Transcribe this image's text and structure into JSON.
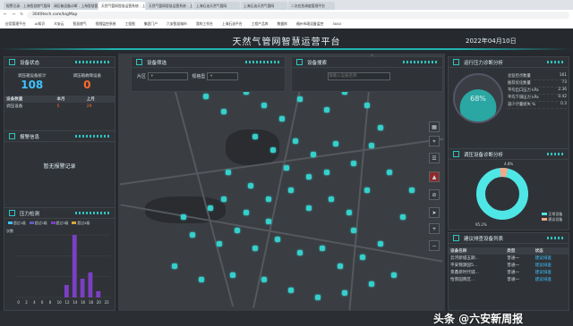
{
  "browser": {
    "tabs": [
      "报警记录 - 上海智慧燃气管网系统",
      "调压箱设备诊断 - 上海智慧管理平台",
      "天然气管网智慧运营系统 - 上海",
      "天然气管网智慧运营系统 - 上海",
      "上海石油天然气管网",
      "上海石油天然气管网",
      "二次应急调度管理平台"
    ],
    "url": "3040tech.com/bigMap",
    "bookmarks": [
      "应用管理平台",
      "AI知识",
      "众安云",
      "智慧燃气",
      "视频监控系统",
      "工程图",
      "集团门户",
      "六安智慧城市",
      "我的工作台",
      "上海石油平台",
      "工程产品库",
      "数据库",
      "福州市政设备监控",
      "3040"
    ]
  },
  "header": {
    "title": "天然气管网智慧运营平台",
    "date": "2022年04月10日"
  },
  "device_status": {
    "title": "设备状态",
    "total_label": "调压箱设备统计",
    "total": "108",
    "fault_label": "调压箱故障设备",
    "fault": "0",
    "cols": [
      "设备数量",
      "本月",
      "上月"
    ],
    "row": [
      "调压设备",
      "5",
      "29"
    ]
  },
  "alarm": {
    "title": "报警信息",
    "empty": "暂无报警记录"
  },
  "pressure": {
    "title": "压力检测",
    "legends": [
      "超过1级",
      "超过2级",
      "超过3级",
      "超过4级"
    ],
    "legend_colors": [
      "#3ec2ff",
      "#5b5fc7",
      "#7b3fc4",
      "#d6a83a"
    ],
    "unit": "次数",
    "xticks": [
      "0",
      "2",
      "4",
      "6",
      "8",
      "10",
      "12",
      "14",
      "16",
      "18",
      "20",
      "22"
    ]
  },
  "filter": {
    "title": "设备筛选",
    "area_label": "片区",
    "spec_label": "规格型"
  },
  "search": {
    "title": "设备搜索",
    "placeholder": "请输入设备名称"
  },
  "runtime": {
    "title": "运行压力诊断分析",
    "percent": "68%",
    "rows": [
      {
        "k": "总监控点数量",
        "v": "161"
      },
      {
        "k": "推荐优化数量",
        "v": "73"
      },
      {
        "k": "平均出口压力 kPa",
        "v": "2.36"
      },
      {
        "k": "平均下调压力 kPa",
        "v": "0.42"
      },
      {
        "k": "减少计量损失 %",
        "v": "0.3"
      }
    ]
  },
  "regulator": {
    "title": "调压设备诊断分析",
    "pct_small": "4.8%",
    "pct_big": "95.2%",
    "legend": [
      "正常设备",
      "建议设备"
    ],
    "colors": [
      "#4fe6e6",
      "#f2a98a"
    ]
  },
  "inspection": {
    "title": "建议排查设备列表",
    "cols": [
      "设备名称",
      "类型",
      "状态"
    ],
    "rows": [
      [
        "云河新城五期...",
        "普通一",
        "建议排查"
      ],
      [
        "平安锦源园5...",
        "普通一",
        "建议排查"
      ],
      [
        "景鑫新时代城...",
        "普通一",
        "建议排查"
      ],
      [
        "怡景园南区...",
        "普通一",
        "建议排查"
      ]
    ]
  },
  "watermark": "头条 @六安新周报",
  "chart_data": {
    "type": "bar",
    "title": "",
    "ylabel": "次数",
    "x": [
      0,
      2,
      4,
      6,
      8,
      10,
      12,
      14,
      16,
      18,
      20,
      22
    ],
    "series": [
      {
        "name": "超过3级",
        "values": [
          0,
          0,
          0,
          0,
          0,
          0,
          2,
          10,
          3,
          4,
          1,
          0
        ]
      }
    ]
  }
}
